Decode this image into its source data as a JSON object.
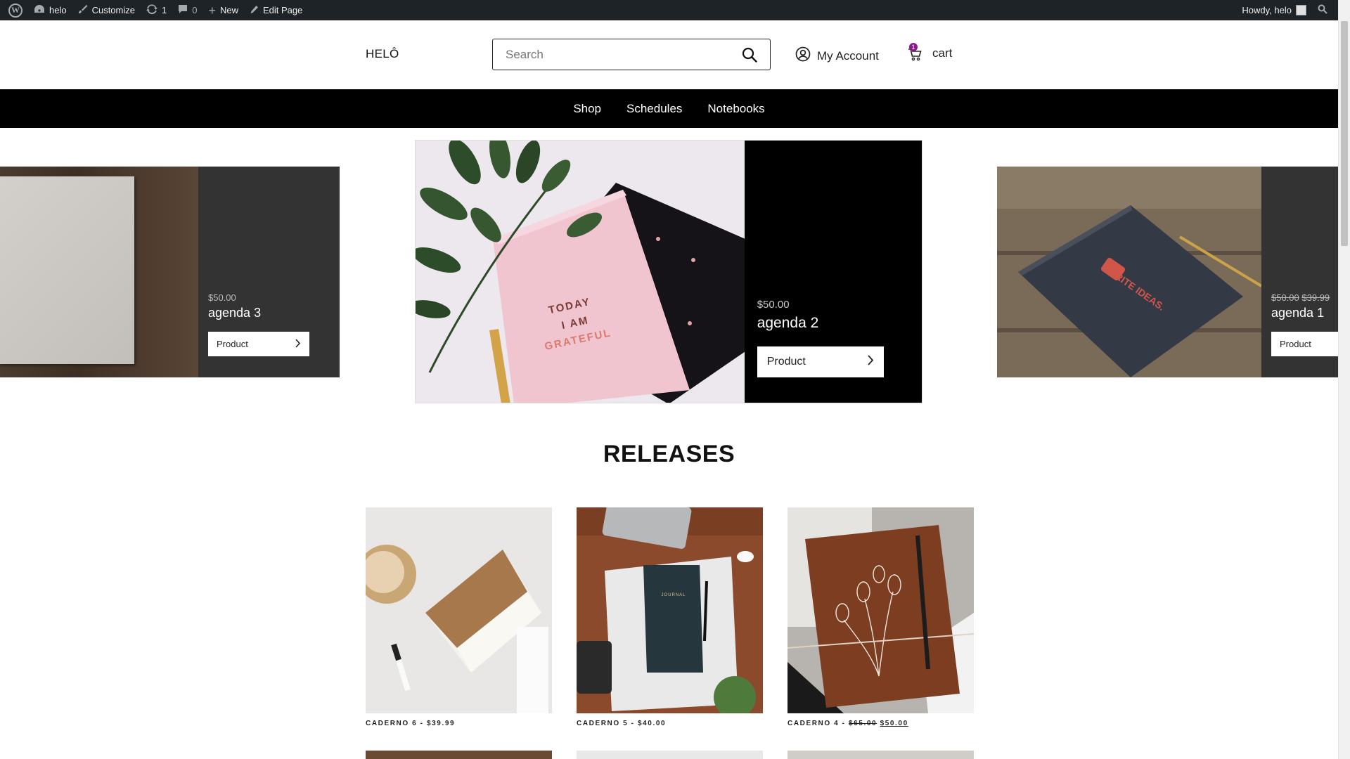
{
  "admin_bar": {
    "site_name": "helo",
    "customize": "Customize",
    "updates_count": "1",
    "comments_count": "0",
    "new_label": "New",
    "edit_page": "Edit Page",
    "howdy": "Howdy, helo"
  },
  "header": {
    "logo": "HELÔ",
    "search_placeholder": "Search",
    "account_label": "My Account",
    "cart_label": "cart",
    "cart_count": "1",
    "badge_color": "#8a1a8a"
  },
  "nav": {
    "items": [
      {
        "label": "Shop"
      },
      {
        "label": "Schedules"
      },
      {
        "label": "Notebooks"
      }
    ]
  },
  "carousel": {
    "slides": [
      {
        "price": "$50.00",
        "title": "agenda 3",
        "button": "Product"
      },
      {
        "price": "$50.00",
        "title": "agenda 2",
        "button": "Product",
        "book_text": "TODAY I AM GRATEFUL"
      },
      {
        "price_old": "$50.00",
        "price_new": "$39.99",
        "title": "agenda 1",
        "button": "Product",
        "book_text": "WRITE IDEAS."
      }
    ]
  },
  "releases": {
    "title": "RELEASES",
    "products": [
      {
        "name": "CADERNO 6",
        "sep": " - ",
        "price": "$39.99"
      },
      {
        "name": "CADERNO 5",
        "sep": " - ",
        "price": "$40.00",
        "book_text": "JOURNAL"
      },
      {
        "name": "CADERNO 4",
        "sep": " - ",
        "price_old": "$65.00",
        "price_new": "$50.00"
      }
    ]
  }
}
